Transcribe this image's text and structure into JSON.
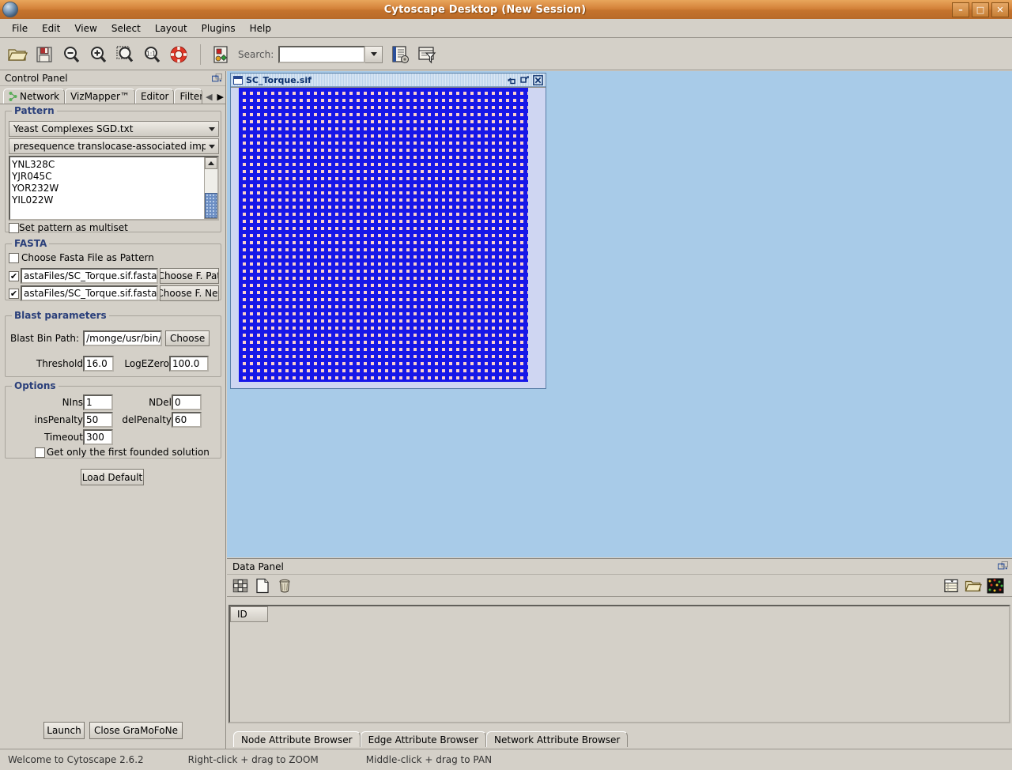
{
  "window": {
    "title": "Cytoscape Desktop (New Session)",
    "app_icon": "cytoscape-logo-icon",
    "controls": [
      {
        "name": "minimize-button",
        "glyph": "–"
      },
      {
        "name": "maximize-button",
        "glyph": "□"
      },
      {
        "name": "close-button",
        "glyph": "✕"
      }
    ]
  },
  "menubar": {
    "items": [
      "File",
      "Edit",
      "View",
      "Select",
      "Layout",
      "Plugins",
      "Help"
    ]
  },
  "toolbar": {
    "buttons": [
      {
        "name": "open-file-icon",
        "tip": "Open"
      },
      {
        "name": "save-icon",
        "tip": "Save"
      },
      {
        "name": "zoom-out-icon",
        "tip": "Zoom Out"
      },
      {
        "name": "zoom-in-icon",
        "tip": "Zoom In"
      },
      {
        "name": "zoom-selected-icon",
        "tip": "Zoom Selected"
      },
      {
        "name": "zoom-actual-size-icon",
        "tip": "Actual Size"
      },
      {
        "name": "life-ring-icon",
        "tip": "Show/Hide Network Overview"
      },
      {
        "name": "network-panel-icon",
        "tip": "Show/Hide Control Panel"
      }
    ],
    "search_label": "Search:",
    "search_value": "",
    "search_placeholder": "",
    "right_buttons": [
      {
        "name": "attribute-browser-icon",
        "tip": "Show/Hide Data Panel"
      },
      {
        "name": "filter-icon",
        "tip": "Filters"
      }
    ]
  },
  "control_panel": {
    "title": "Control Panel",
    "float_icon": "float-panel-icon",
    "tabs": [
      {
        "label": "Network",
        "icon": "network-tree-icon",
        "selected": true
      },
      {
        "label": "VizMapper™",
        "selected": false
      },
      {
        "label": "Editor",
        "selected": false
      },
      {
        "label": "Filter",
        "selected": false
      }
    ],
    "tab_scroll_left": "◀",
    "tab_scroll_right": "▶",
    "pattern": {
      "legend": "Pattern",
      "file_combo": "Yeast Complexes SGD.txt",
      "complex_combo": "presequence translocase-associated imp...",
      "list_items": [
        "YNL328C",
        "YJR045C",
        "YOR232W",
        "YIL022W"
      ],
      "multiset_label": "Set pattern as multiset",
      "multiset_checked": false
    },
    "fasta": {
      "legend": "FASTA",
      "choose_fasta_label": "Choose Fasta File as Pattern",
      "choose_fasta_checked": false,
      "rows": [
        {
          "checked": true,
          "value": "astaFiles/SC_Torque.sif.fasta",
          "button": "Choose F. Pat"
        },
        {
          "checked": true,
          "value": "astaFiles/SC_Torque.sif.fasta",
          "button": "Choose F. Net"
        }
      ]
    },
    "blast": {
      "legend": "Blast parameters",
      "bin_path_label": "Blast Bin Path:",
      "bin_path_value": "/monge/usr/bin/",
      "choose_button": "Choose",
      "threshold_label": "Threshold",
      "threshold_value": "16.0",
      "logezero_label": "LogEZero",
      "logezero_value": "100.0"
    },
    "options": {
      "legend": "Options",
      "nins_label": "NIns",
      "nins_value": "1",
      "ndel_label": "NDel",
      "ndel_value": "0",
      "inspenalty_label": "insPenalty",
      "inspenalty_value": "50",
      "delpenalty_label": "delPenalty",
      "delpenalty_value": "60",
      "timeout_label": "Timeout",
      "timeout_value": "300",
      "first_solution_label": "Get only the first founded solution",
      "first_solution_checked": false
    },
    "load_default_button": "Load Default",
    "launch_button": "Launch",
    "close_button": "Close GraMoFoNe"
  },
  "network_view": {
    "frame_title": "SC_Torque.sif",
    "frame_icon": "window-icon",
    "controls": [
      {
        "name": "restore-down-icon",
        "glyph": "⤡"
      },
      {
        "name": "maximize-frame-icon",
        "glyph": "↗"
      },
      {
        "name": "close-frame-icon",
        "glyph": "☒"
      }
    ],
    "node_color": "#1717e8",
    "background_color": "#fbd0cc",
    "canvas_color": "#cfd6f2",
    "desktop_color": "#a8cbe8"
  },
  "data_panel": {
    "title": "Data Panel",
    "float_icon": "float-panel-icon",
    "toolbar_left": [
      {
        "name": "select-all-table-icon"
      },
      {
        "name": "new-document-icon"
      },
      {
        "name": "delete-trash-icon"
      }
    ],
    "toolbar_right": [
      {
        "name": "table-export-icon"
      },
      {
        "name": "open-folder-icon"
      },
      {
        "name": "network-heatmap-icon"
      }
    ],
    "columns": [
      "ID"
    ],
    "rows": [],
    "tabs": [
      {
        "label": "Node Attribute Browser",
        "selected": true
      },
      {
        "label": "Edge Attribute Browser",
        "selected": false
      },
      {
        "label": "Network Attribute Browser",
        "selected": false
      }
    ]
  },
  "statusbar": {
    "welcome": "Welcome to Cytoscape 2.6.2",
    "zoom_hint": "Right-click + drag  to  ZOOM",
    "pan_hint": "Middle-click + drag  to  PAN"
  }
}
